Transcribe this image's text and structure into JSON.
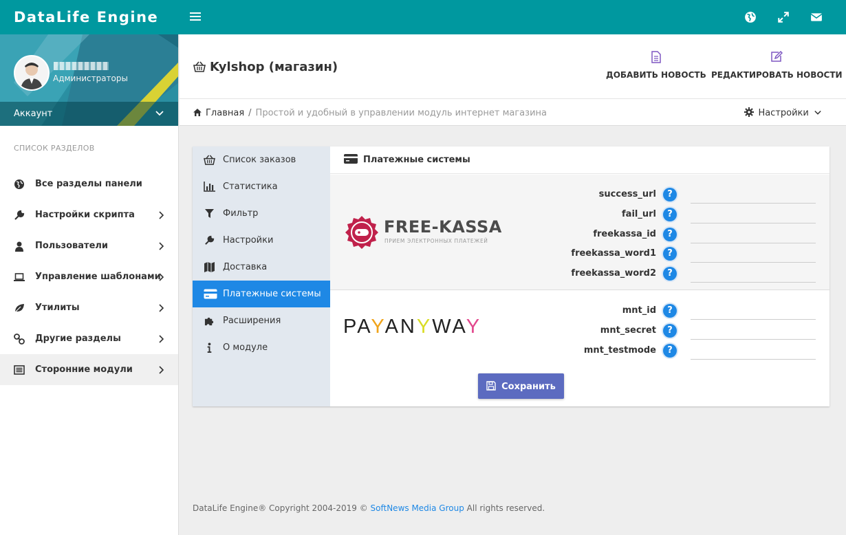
{
  "app": {
    "brand": "DataLife Engine"
  },
  "topbar": {
    "icons": [
      "globe-icon",
      "expand-icon",
      "envelope-icon"
    ]
  },
  "sidebar": {
    "role": "Администраторы",
    "account_label": "Аккаунт",
    "section_title": "Список разделов",
    "items": [
      {
        "label": "Все разделы панели",
        "icon": "globe-icon"
      },
      {
        "label": "Настройки скрипта",
        "icon": "wrench-icon"
      },
      {
        "label": "Пользователи",
        "icon": "user-icon"
      },
      {
        "label": "Управление шаблонами",
        "icon": "laptop-icon"
      },
      {
        "label": "Утилиты",
        "icon": "leaf-icon"
      },
      {
        "label": "Другие разделы",
        "icon": "link-icon"
      },
      {
        "label": "Сторонние модули",
        "icon": "list-icon"
      }
    ]
  },
  "header": {
    "title": "Kylshop (магазин)",
    "actions": [
      {
        "label": "ДОБАВИТЬ НОВОСТЬ",
        "icon": "file-icon"
      },
      {
        "label": "РЕДАКТИРОВАТЬ НОВОСТИ",
        "icon": "edit-icon"
      }
    ]
  },
  "breadcrumb": {
    "home": "Главная",
    "separator": "/",
    "current": "Простой и удобный в управлении модуль интернет магазина",
    "settings_label": "Настройки"
  },
  "tabs": [
    {
      "label": "Список заказов",
      "icon": "basket-icon"
    },
    {
      "label": "Статистика",
      "icon": "bar-chart-icon"
    },
    {
      "label": "Фильтр",
      "icon": "filter-icon"
    },
    {
      "label": "Настройки",
      "icon": "wrench-icon"
    },
    {
      "label": "Доставка",
      "icon": "map-icon"
    },
    {
      "label": "Платежные системы",
      "icon": "credit-card-icon"
    },
    {
      "label": "Расширения",
      "icon": "puzzle-icon"
    },
    {
      "label": "О модуле",
      "icon": "info-icon"
    }
  ],
  "content": {
    "title": "Платежные системы",
    "help_glyph": "?",
    "freekassa": {
      "logo_title": "FREE-KASSA",
      "logo_subtitle": "ПРИЕМ ЭЛЕКТРОННЫХ ПЛАТЕЖЕЙ",
      "fields": [
        {
          "label": "success_url",
          "value": ""
        },
        {
          "label": "fail_url",
          "value": ""
        },
        {
          "label": "freekassa_id",
          "value": ""
        },
        {
          "label": "freekassa_word1",
          "value": ""
        },
        {
          "label": "freekassa_word2",
          "value": ""
        }
      ]
    },
    "payanyway": {
      "logo_parts": [
        "PA",
        "Y",
        "AN",
        "Y",
        "WA",
        "Y"
      ],
      "fields": [
        {
          "label": "mnt_id",
          "value": ""
        },
        {
          "label": "mnt_secret",
          "value": ""
        },
        {
          "label": "mnt_testmode",
          "value": ""
        }
      ]
    },
    "save_label": "Сохранить"
  },
  "footer": {
    "text_before": "DataLife Engine® Copyright 2004-2019 © ",
    "link": "SoftNews Media Group",
    "text_after": " All rights reserved."
  },
  "colors": {
    "topbar": "#00989f",
    "accent": "#1e88e5",
    "save_button": "#5c6bc0",
    "freekassa": "#c0214b",
    "payanyway_y": "#f0a41b",
    "payanyway_y2": "#d9dd25",
    "payanyway_y3": "#e2488d"
  }
}
